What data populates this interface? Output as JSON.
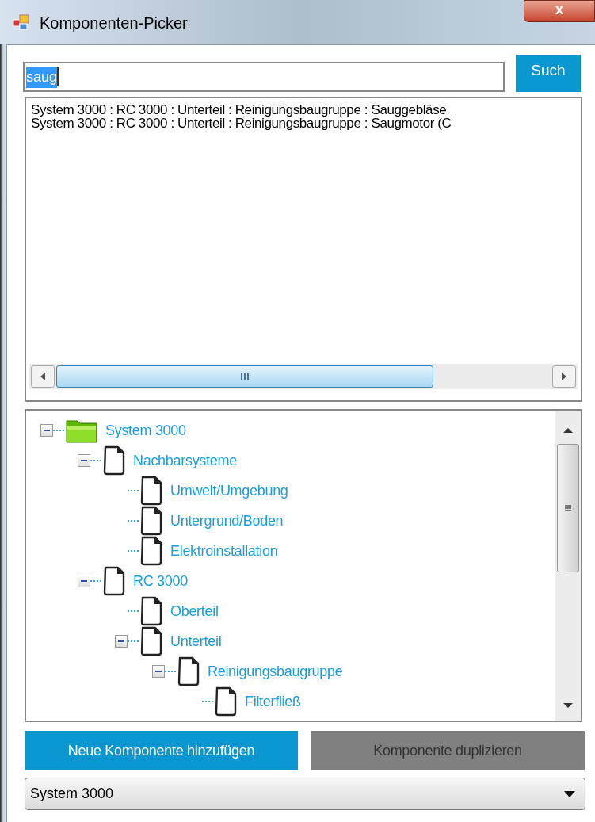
{
  "window": {
    "title": "Komponenten-Picker",
    "close_label": "x"
  },
  "search": {
    "value": "saug",
    "text_selected": true,
    "button": "Such"
  },
  "results": [
    "System 3000 : RC 3000 : Unterteil : Reinigungsbaugruppe : Sauggebläse",
    "System 3000 : RC 3000 : Unterteil : Reinigungsbaugruppe : Saugmotor (C"
  ],
  "tree": [
    {
      "label": "System 3000",
      "kind": "folder",
      "expanded": true,
      "children": [
        {
          "label": "Nachbarsysteme",
          "kind": "page",
          "expanded": true,
          "children": [
            {
              "label": "Umwelt/Umgebung",
              "kind": "page"
            },
            {
              "label": "Untergrund/Boden",
              "kind": "page"
            },
            {
              "label": "Elektroinstallation",
              "kind": "page"
            }
          ]
        },
        {
          "label": "RC 3000",
          "kind": "page",
          "expanded": true,
          "children": [
            {
              "label": "Oberteil",
              "kind": "page"
            },
            {
              "label": "Unterteil",
              "kind": "page",
              "expanded": true,
              "children": [
                {
                  "label": "Reinigungsbaugruppe",
                  "kind": "page",
                  "expanded": true,
                  "children": [
                    {
                      "label": "Filterfließ",
                      "kind": "page"
                    }
                  ]
                }
              ]
            }
          ]
        }
      ]
    }
  ],
  "buttons": [
    {
      "label": "Neue Komponente hinzufügen",
      "disabled": false
    },
    {
      "label": "Komponente duplizieren",
      "disabled": true
    }
  ],
  "dropdown": {
    "value": "System 3000"
  }
}
